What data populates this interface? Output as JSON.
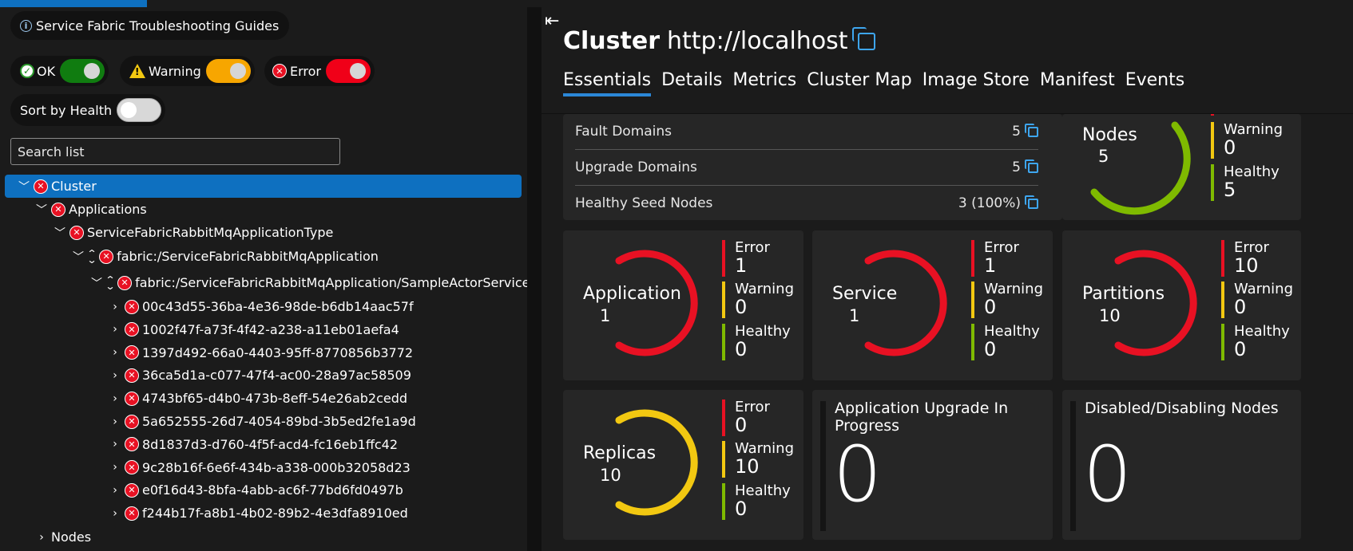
{
  "left": {
    "guides_label": "Service Fabric Troubleshooting Guides",
    "filters": {
      "ok": "OK",
      "warning": "Warning",
      "error": "Error",
      "sort": "Sort by Health"
    },
    "search_placeholder": "Search list",
    "tree": {
      "cluster": "Cluster",
      "applications": "Applications",
      "app_type": "ServiceFabricRabbitMqApplicationType",
      "app": "fabric:/ServiceFabricRabbitMqApplication",
      "service": "fabric:/ServiceFabricRabbitMqApplication/SampleActorService",
      "partitions": [
        "00c43d55-36ba-4e36-98de-b6db14aac57f",
        "1002f47f-a73f-4f42-a238-a11eb01aefa4",
        "1397d492-66a0-4403-95ff-8770856b3772",
        "36ca5d1a-c077-47f4-ac00-28a97ac58509",
        "4743bf65-d4b0-473b-8eff-54e26ab2cedd",
        "5a652555-26d7-4054-89bd-3b5ed2fe1a9d",
        "8d1837d3-d760-4f5f-acd4-fc16eb1ffc42",
        "9c28b16f-6e6f-434b-a338-000b32058d23",
        "e0f16d43-8bfa-4abb-ac6f-77bd6fd0497b",
        "f244b17f-a8b1-4b02-89b2-4e3dfa8910ed"
      ],
      "nodes": "Nodes"
    }
  },
  "right": {
    "title_label": "Cluster",
    "title_url": "http://localhost",
    "tabs": [
      "Essentials",
      "Details",
      "Metrics",
      "Cluster Map",
      "Image Store",
      "Manifest",
      "Events"
    ],
    "essentials": [
      {
        "label": "Fault Domains",
        "value": "5"
      },
      {
        "label": "Upgrade Domains",
        "value": "5"
      },
      {
        "label": "Healthy Seed Nodes",
        "value": "3 (100%)"
      }
    ],
    "nodes_card": {
      "name": "Nodes",
      "total": "5",
      "warning_label": "Warning",
      "warning": "0",
      "healthy_label": "Healthy",
      "healthy": "5"
    },
    "gauges": [
      {
        "name": "Application",
        "total": "1",
        "error": "1",
        "warning": "0",
        "healthy": "0",
        "color": "#e81123"
      },
      {
        "name": "Service",
        "total": "1",
        "error": "1",
        "warning": "0",
        "healthy": "0",
        "color": "#e81123"
      },
      {
        "name": "Partitions",
        "total": "10",
        "error": "10",
        "warning": "0",
        "healthy": "0",
        "color": "#e81123"
      },
      {
        "name": "Replicas",
        "total": "10",
        "error": "0",
        "warning": "10",
        "healthy": "0",
        "color": "#f2c811"
      }
    ],
    "stat_labels": {
      "error": "Error",
      "warning": "Warning",
      "healthy": "Healthy"
    },
    "upgrade_card": {
      "title": "Application Upgrade In Progress",
      "value": "0"
    },
    "disabled_card": {
      "title": "Disabled/Disabling Nodes",
      "value": "0"
    }
  },
  "colors": {
    "error": "#e81123",
    "warning": "#f2c811",
    "healthy": "#7fba00",
    "accent": "#0e70c0"
  }
}
